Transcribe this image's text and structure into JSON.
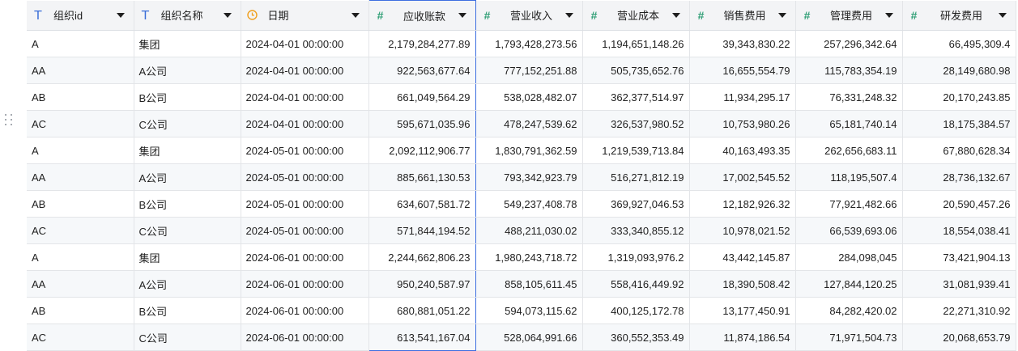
{
  "columns": [
    {
      "label": "组织id",
      "icon": "text-type-icon",
      "align": "left"
    },
    {
      "label": "组织名称",
      "icon": "text-type-icon",
      "align": "left"
    },
    {
      "label": "日期",
      "icon": "clock-icon",
      "align": "left"
    },
    {
      "label": "应收账款",
      "icon": "number-type-icon",
      "align": "right"
    },
    {
      "label": "营业收入",
      "icon": "number-type-icon",
      "align": "right"
    },
    {
      "label": "营业成本",
      "icon": "number-type-icon",
      "align": "right"
    },
    {
      "label": "销售费用",
      "icon": "number-type-icon",
      "align": "right"
    },
    {
      "label": "管理费用",
      "icon": "number-type-icon",
      "align": "right"
    },
    {
      "label": "研发费用",
      "icon": "number-type-icon",
      "align": "right"
    }
  ],
  "selected_column": 3,
  "rows": [
    [
      "A",
      "集团",
      "2024-04-01 00:00:00",
      "2,179,284,277.89",
      "1,793,428,273.56",
      "1,194,651,148.26",
      "39,343,830.22",
      "257,296,342.64",
      "66,495,309.4"
    ],
    [
      "AA",
      "A公司",
      "2024-04-01 00:00:00",
      "922,563,677.64",
      "777,152,251.88",
      "505,735,652.76",
      "16,655,554.79",
      "115,783,354.19",
      "28,149,680.98"
    ],
    [
      "AB",
      "B公司",
      "2024-04-01 00:00:00",
      "661,049,564.29",
      "538,028,482.07",
      "362,377,514.97",
      "11,934,295.17",
      "76,331,248.32",
      "20,170,243.85"
    ],
    [
      "AC",
      "C公司",
      "2024-04-01 00:00:00",
      "595,671,035.96",
      "478,247,539.62",
      "326,537,980.52",
      "10,753,980.26",
      "65,181,740.14",
      "18,175,384.57"
    ],
    [
      "A",
      "集团",
      "2024-05-01 00:00:00",
      "2,092,112,906.77",
      "1,830,791,362.59",
      "1,219,539,713.84",
      "40,163,493.35",
      "262,656,683.11",
      "67,880,628.34"
    ],
    [
      "AA",
      "A公司",
      "2024-05-01 00:00:00",
      "885,661,130.53",
      "793,342,923.79",
      "516,271,812.19",
      "17,002,545.52",
      "118,195,507.4",
      "28,736,132.67"
    ],
    [
      "AB",
      "B公司",
      "2024-05-01 00:00:00",
      "634,607,581.72",
      "549,237,408.78",
      "369,927,046.53",
      "12,182,926.32",
      "77,921,482.66",
      "20,590,457.26"
    ],
    [
      "AC",
      "C公司",
      "2024-05-01 00:00:00",
      "571,844,194.52",
      "488,211,030.02",
      "333,340,855.12",
      "10,978,021.52",
      "66,539,693.06",
      "18,554,038.41"
    ],
    [
      "A",
      "集团",
      "2024-06-01 00:00:00",
      "2,244,662,806.23",
      "1,980,243,718.72",
      "1,319,093,976.2",
      "43,442,145.87",
      "284,098,045",
      "73,421,904.13"
    ],
    [
      "AA",
      "A公司",
      "2024-06-01 00:00:00",
      "950,240,587.97",
      "858,105,611.45",
      "558,416,449.92",
      "18,390,508.42",
      "127,844,120.25",
      "31,081,939.41"
    ],
    [
      "AB",
      "B公司",
      "2024-06-01 00:00:00",
      "680,881,051.22",
      "594,073,115.62",
      "400,125,172.78",
      "13,177,450.91",
      "84,282,420.02",
      "22,271,310.92"
    ],
    [
      "AC",
      "C公司",
      "2024-06-01 00:00:00",
      "613,541,167.04",
      "528,064,991.66",
      "360,552,353.49",
      "11,874,186.54",
      "71,971,504.73",
      "20,068,653.79"
    ]
  ],
  "colors": {
    "accent": "#3d6ee0",
    "text_icon": "#3b6fd8",
    "number_icon": "#2e9e74",
    "date_icon": "#f0a020",
    "header_bg": "#f3f4f6",
    "stripe_bg": "#f6f8fa",
    "border": "#e3e5e8"
  }
}
